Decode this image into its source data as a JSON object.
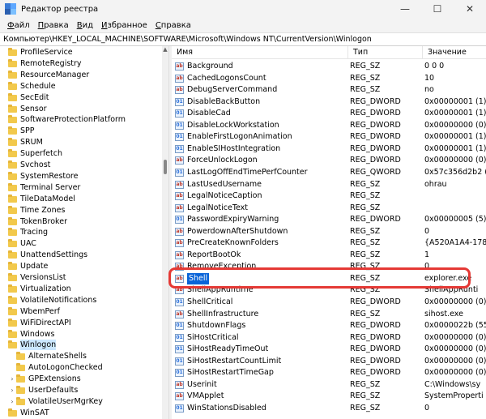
{
  "window": {
    "title": "Редактор реестра",
    "minimize": "—",
    "maximize": "☐",
    "close": "✕"
  },
  "menu": [
    {
      "u": "Ф",
      "rest": "айл"
    },
    {
      "u": "П",
      "rest": "равка"
    },
    {
      "u": "В",
      "rest": "ид"
    },
    {
      "u": "И",
      "rest": "збранное"
    },
    {
      "u": "С",
      "rest": "правка"
    }
  ],
  "address": "Компьютер\\HKEY_LOCAL_MACHINE\\SOFTWARE\\Microsoft\\Windows NT\\CurrentVersion\\Winlogon",
  "tree": [
    {
      "label": "ProfileService",
      "level": 0
    },
    {
      "label": "RemoteRegistry",
      "level": 0
    },
    {
      "label": "ResourceManager",
      "level": 0
    },
    {
      "label": "Schedule",
      "level": 0
    },
    {
      "label": "SecEdit",
      "level": 0
    },
    {
      "label": "Sensor",
      "level": 0
    },
    {
      "label": "SoftwareProtectionPlatform",
      "level": 0
    },
    {
      "label": "SPP",
      "level": 0
    },
    {
      "label": "SRUM",
      "level": 0
    },
    {
      "label": "Superfetch",
      "level": 0
    },
    {
      "label": "Svchost",
      "level": 0
    },
    {
      "label": "SystemRestore",
      "level": 0
    },
    {
      "label": "Terminal Server",
      "level": 0
    },
    {
      "label": "TileDataModel",
      "level": 0
    },
    {
      "label": "Time Zones",
      "level": 0
    },
    {
      "label": "TokenBroker",
      "level": 0
    },
    {
      "label": "Tracing",
      "level": 0
    },
    {
      "label": "UAC",
      "level": 0
    },
    {
      "label": "UnattendSettings",
      "level": 0
    },
    {
      "label": "Update",
      "level": 0
    },
    {
      "label": "VersionsList",
      "level": 0
    },
    {
      "label": "Virtualization",
      "level": 0
    },
    {
      "label": "VolatileNotifications",
      "level": 0
    },
    {
      "label": "WbemPerf",
      "level": 0
    },
    {
      "label": "WiFiDirectAPI",
      "level": 0
    },
    {
      "label": "Windows",
      "level": 0
    },
    {
      "label": "Winlogon",
      "level": 0,
      "selected": true,
      "expanded": true
    },
    {
      "label": "AlternateShells",
      "level": 1
    },
    {
      "label": "AutoLogonChecked",
      "level": 1
    },
    {
      "label": "GPExtensions",
      "level": 1,
      "chevron": true
    },
    {
      "label": "UserDefaults",
      "level": 1,
      "chevron": true
    },
    {
      "label": "VolatileUserMgrKey",
      "level": 1,
      "chevron": true
    },
    {
      "label": "WinSAT",
      "level": 0
    }
  ],
  "columns": {
    "name": "Имя",
    "type": "Тип",
    "value": "Значение"
  },
  "values": [
    {
      "icon": "ab",
      "name": "Background",
      "type": "REG_SZ",
      "value": "0 0 0"
    },
    {
      "icon": "ab",
      "name": "CachedLogonsCount",
      "type": "REG_SZ",
      "value": "10"
    },
    {
      "icon": "ab",
      "name": "DebugServerCommand",
      "type": "REG_SZ",
      "value": "no"
    },
    {
      "icon": "bin",
      "name": "DisableBackButton",
      "type": "REG_DWORD",
      "value": "0x00000001 (1)"
    },
    {
      "icon": "bin",
      "name": "DisableCad",
      "type": "REG_DWORD",
      "value": "0x00000001 (1)"
    },
    {
      "icon": "bin",
      "name": "DisableLockWorkstation",
      "type": "REG_DWORD",
      "value": "0x00000000 (0)"
    },
    {
      "icon": "bin",
      "name": "EnableFirstLogonAnimation",
      "type": "REG_DWORD",
      "value": "0x00000001 (1)"
    },
    {
      "icon": "bin",
      "name": "EnableSIHostIntegration",
      "type": "REG_DWORD",
      "value": "0x00000001 (1)"
    },
    {
      "icon": "ab",
      "name": "ForceUnlockLogon",
      "type": "REG_DWORD",
      "value": "0x00000000 (0)"
    },
    {
      "icon": "bin",
      "name": "LastLogOffEndTimePerfCounter",
      "type": "REG_QWORD",
      "value": "0x57c356d2b2 ("
    },
    {
      "icon": "ab",
      "name": "LastUsedUsername",
      "type": "REG_SZ",
      "value": "ohrau"
    },
    {
      "icon": "ab",
      "name": "LegalNoticeCaption",
      "type": "REG_SZ",
      "value": ""
    },
    {
      "icon": "ab",
      "name": "LegalNoticeText",
      "type": "REG_SZ",
      "value": ""
    },
    {
      "icon": "bin",
      "name": "PasswordExpiryWarning",
      "type": "REG_DWORD",
      "value": "0x00000005 (5)"
    },
    {
      "icon": "ab",
      "name": "PowerdownAfterShutdown",
      "type": "REG_SZ",
      "value": "0"
    },
    {
      "icon": "ab",
      "name": "PreCreateKnownFolders",
      "type": "REG_SZ",
      "value": "{A520A1A4-178"
    },
    {
      "icon": "ab",
      "name": "ReportBootOk",
      "type": "REG_SZ",
      "value": "1"
    },
    {
      "icon": "ab",
      "name": "RemoveException",
      "type": "REG_SZ",
      "value": "0"
    },
    {
      "icon": "ab",
      "name": "Shell",
      "type": "REG_SZ",
      "value": "explorer.exe",
      "selected": true
    },
    {
      "icon": "ab",
      "name": "ShellAppRuntime",
      "type": "REG_SZ",
      "value": "ShellAppRunti"
    },
    {
      "icon": "bin",
      "name": "ShellCritical",
      "type": "REG_DWORD",
      "value": "0x00000000 (0)"
    },
    {
      "icon": "ab",
      "name": "ShellInfrastructure",
      "type": "REG_SZ",
      "value": "sihost.exe"
    },
    {
      "icon": "bin",
      "name": "ShutdownFlags",
      "type": "REG_DWORD",
      "value": "0x0000022b (55"
    },
    {
      "icon": "bin",
      "name": "SiHostCritical",
      "type": "REG_DWORD",
      "value": "0x00000000 (0)"
    },
    {
      "icon": "bin",
      "name": "SiHostReadyTimeOut",
      "type": "REG_DWORD",
      "value": "0x00000000 (0)"
    },
    {
      "icon": "bin",
      "name": "SiHostRestartCountLimit",
      "type": "REG_DWORD",
      "value": "0x00000000 (0)"
    },
    {
      "icon": "bin",
      "name": "SiHostRestartTimeGap",
      "type": "REG_DWORD",
      "value": "0x00000000 (0)"
    },
    {
      "icon": "ab",
      "name": "Userinit",
      "type": "REG_SZ",
      "value": "C:\\Windows\\sy"
    },
    {
      "icon": "ab",
      "name": "VMApplet",
      "type": "REG_SZ",
      "value": "SystemProperti"
    },
    {
      "icon": "bin",
      "name": "WinStationsDisabled",
      "type": "REG_SZ",
      "value": "0"
    }
  ]
}
